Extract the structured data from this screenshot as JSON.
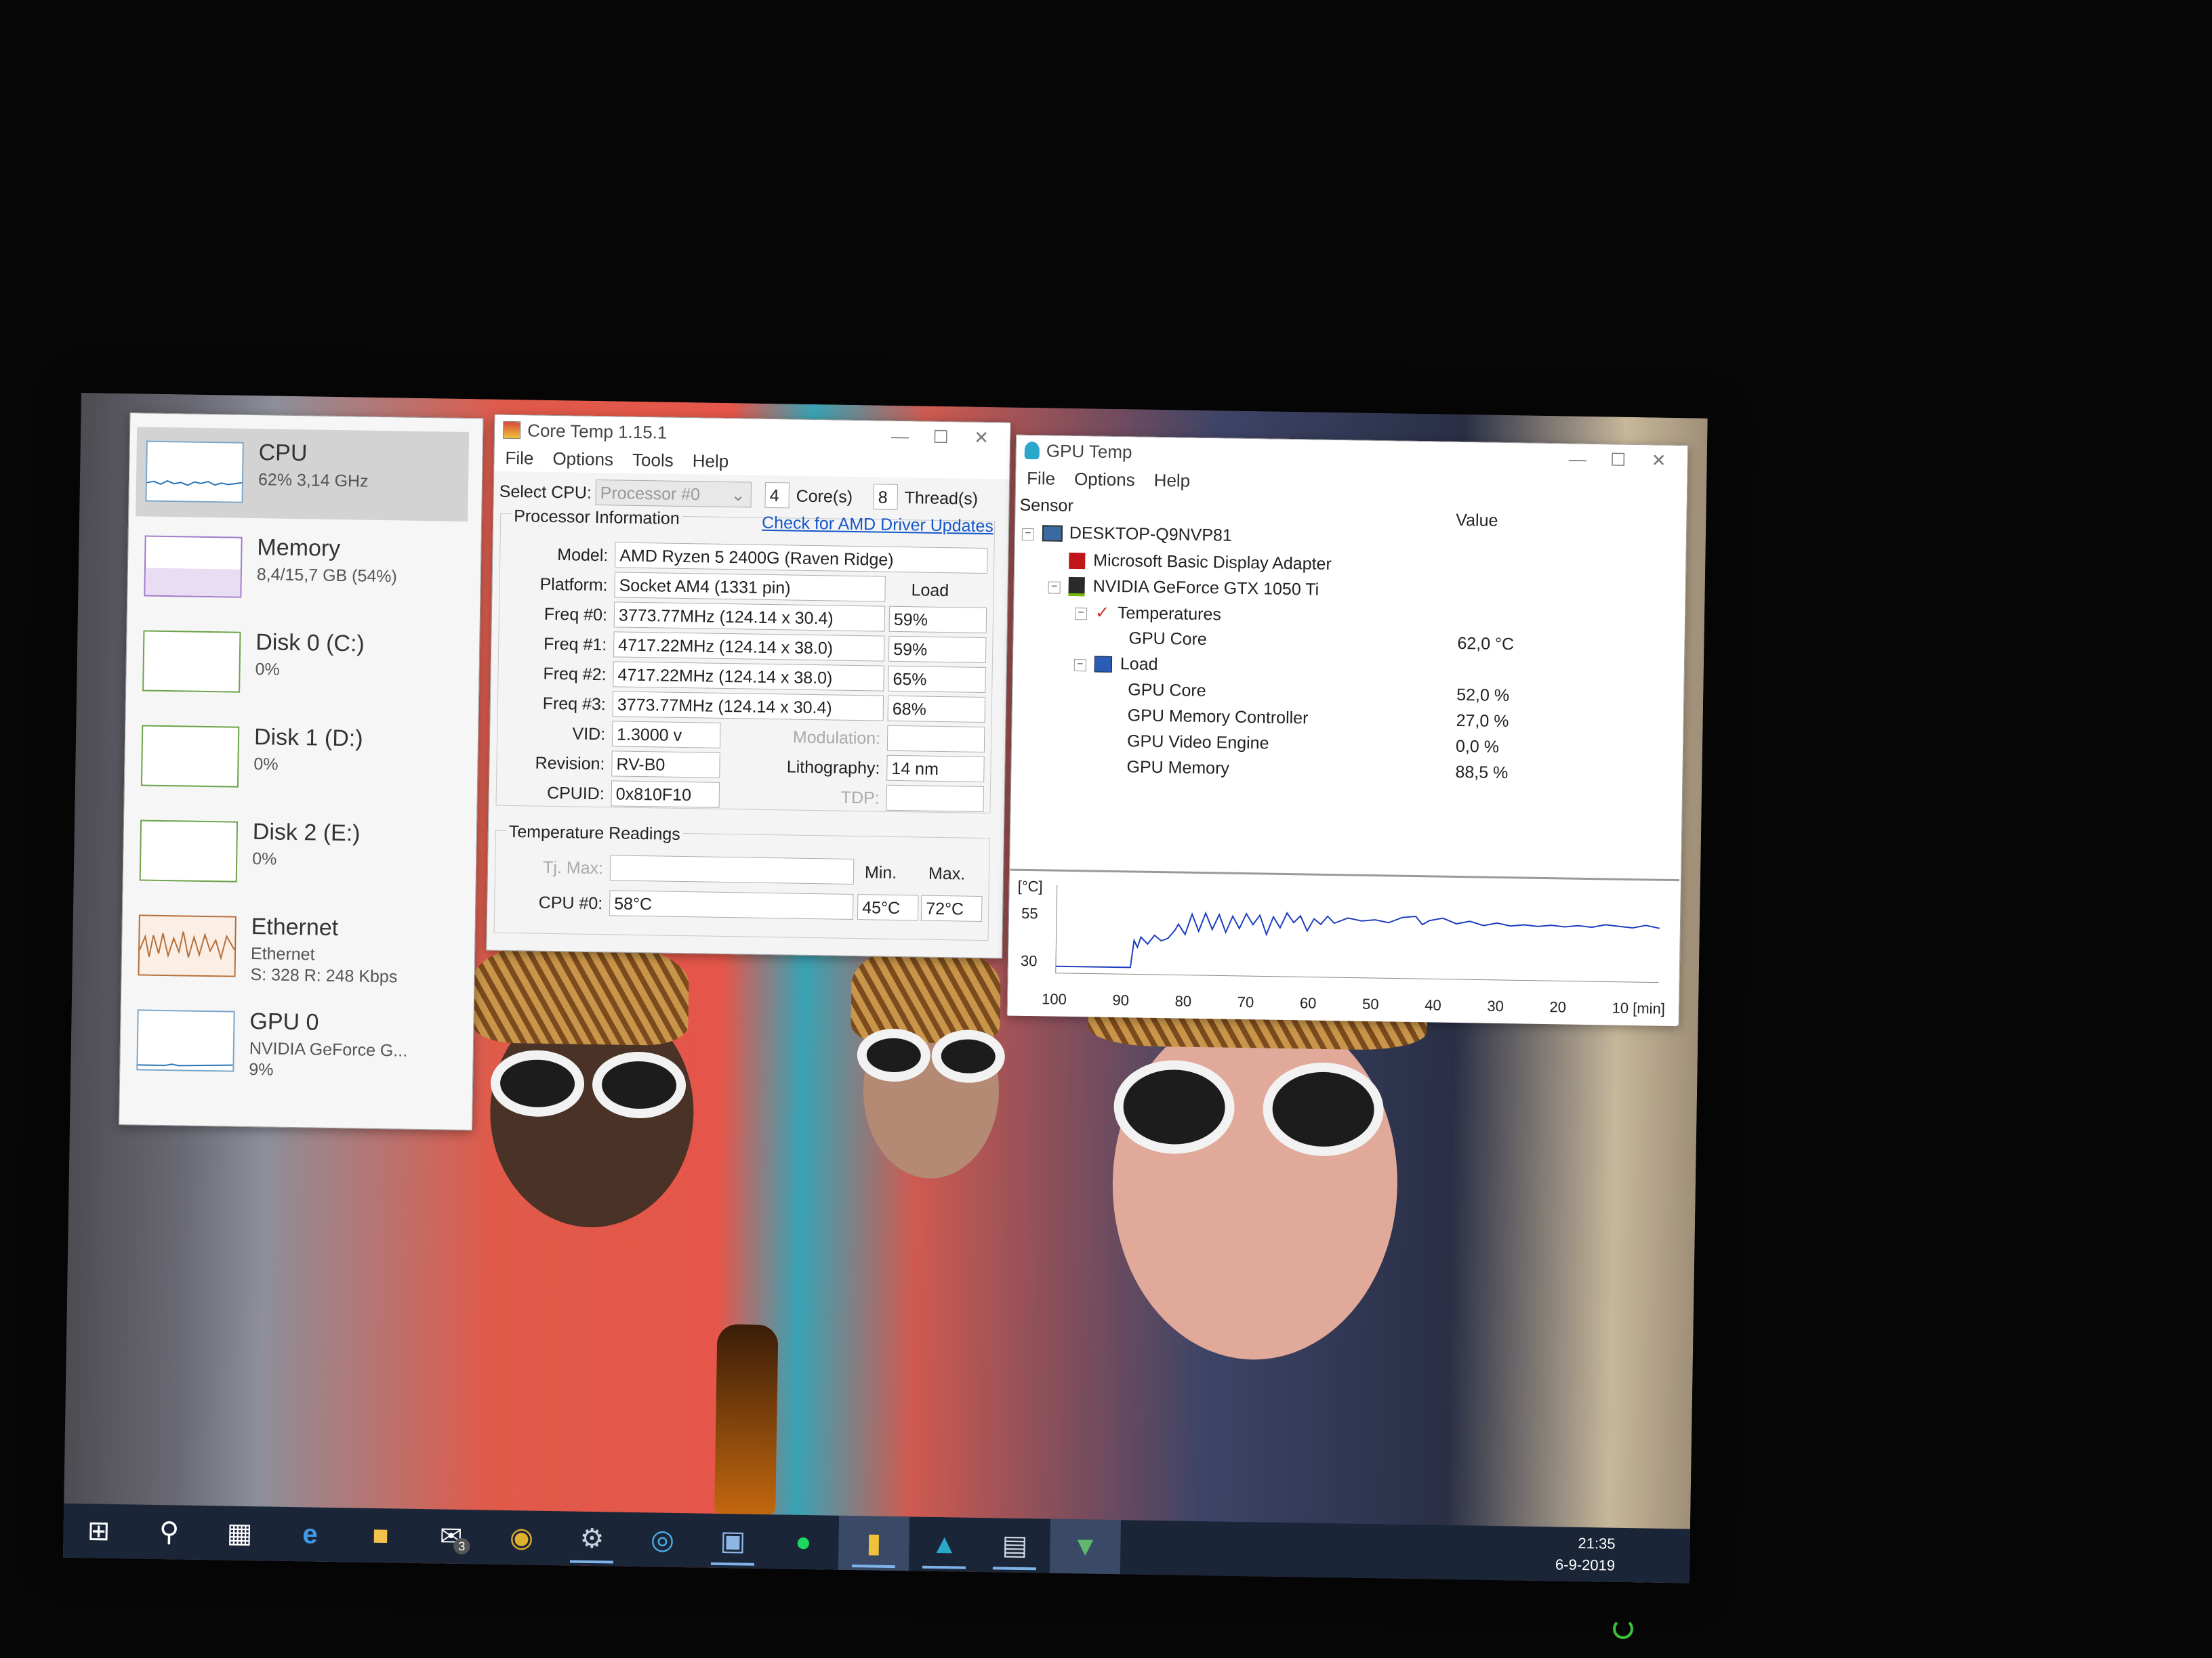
{
  "taskmgr": {
    "items": [
      {
        "name": "CPU",
        "sub1": "62% 3,14 GHz",
        "sub2": "",
        "sub3": ""
      },
      {
        "name": "Memory",
        "sub1": "8,4/15,7 GB (54%)",
        "sub2": "",
        "sub3": ""
      },
      {
        "name": "Disk 0 (C:)",
        "sub1": "0%",
        "sub2": "",
        "sub3": ""
      },
      {
        "name": "Disk 1 (D:)",
        "sub1": "0%",
        "sub2": "",
        "sub3": ""
      },
      {
        "name": "Disk 2 (E:)",
        "sub1": "0%",
        "sub2": "",
        "sub3": ""
      },
      {
        "name": "Ethernet",
        "sub1": "Ethernet",
        "sub2": "S: 328 R: 248 Kbps",
        "sub3": ""
      },
      {
        "name": "GPU 0",
        "sub1": "NVIDIA GeForce G...",
        "sub2": "9%",
        "sub3": ""
      }
    ]
  },
  "coretemp": {
    "title": "Core Temp 1.15.1",
    "menu": [
      "File",
      "Options",
      "Tools",
      "Help"
    ],
    "select_cpu_label": "Select CPU:",
    "processor": "Processor #0",
    "cores_value": "4",
    "cores_label": "Core(s)",
    "threads_value": "8",
    "threads_label": "Thread(s)",
    "proc_info_label": "Processor Information",
    "driver_link": "Check for AMD Driver Updates",
    "model_label": "Model:",
    "model": "AMD Ryzen 5 2400G (Raven Ridge)",
    "platform_label": "Platform:",
    "platform": "Socket AM4 (1331 pin)",
    "load_header": "Load",
    "freqs": [
      {
        "label": "Freq #0:",
        "value": "3773.77MHz (124.14 x 30.4)",
        "load": "59%"
      },
      {
        "label": "Freq #1:",
        "value": "4717.22MHz (124.14 x 38.0)",
        "load": "59%"
      },
      {
        "label": "Freq #2:",
        "value": "4717.22MHz (124.14 x 38.0)",
        "load": "65%"
      },
      {
        "label": "Freq #3:",
        "value": "3773.77MHz (124.14 x 30.4)",
        "load": "68%"
      }
    ],
    "vid_label": "VID:",
    "vid": "1.3000 v",
    "modulation_label": "Modulation:",
    "revision_label": "Revision:",
    "revision": "RV-B0",
    "lithography_label": "Lithography:",
    "lithography": "14 nm",
    "cpuid_label": "CPUID:",
    "cpuid": "0x810F10",
    "tdp_label": "TDP:",
    "temp_readings_label": "Temperature Readings",
    "tjmax_label": "Tj. Max:",
    "min_header": "Min.",
    "max_header": "Max.",
    "cpu0_label": "CPU #0:",
    "cpu0_temp": "58°C",
    "cpu0_min": "45°C",
    "cpu0_max": "72°C"
  },
  "gputemp": {
    "title": "GPU Temp",
    "menu": [
      "File",
      "Options",
      "Help"
    ],
    "sensor_header": "Sensor",
    "value_header": "Value",
    "tree": [
      {
        "label": "DESKTOP-Q9NVP81",
        "value": ""
      },
      {
        "label": "Microsoft Basic Display Adapter",
        "value": ""
      },
      {
        "label": "NVIDIA GeForce GTX 1050 Ti",
        "value": ""
      },
      {
        "label": "Temperatures",
        "value": ""
      },
      {
        "label": "GPU Core",
        "value": "62,0 °C"
      },
      {
        "label": "Load",
        "value": ""
      },
      {
        "label": "GPU Core",
        "value": "52,0 %"
      },
      {
        "label": "GPU Memory Controller",
        "value": "27,0 %"
      },
      {
        "label": "GPU Video Engine",
        "value": "0,0 %"
      },
      {
        "label": "GPU Memory",
        "value": "88,5 %"
      }
    ],
    "graph": {
      "unit": "[°C]",
      "y_ticks": [
        "55",
        "30"
      ],
      "x_ticks": [
        "100",
        "90",
        "80",
        "70",
        "60",
        "50",
        "40",
        "30",
        "20",
        "10 [min]"
      ],
      "line_color": "#1f3fbf"
    }
  },
  "taskbar": {
    "icons": [
      "windows-start-icon",
      "search-icon",
      "task-view-icon",
      "edge-icon",
      "file-explorer-icon",
      "mail-icon",
      "chrome-icon",
      "steam-icon",
      "uplay-icon",
      "photos-icon",
      "spotify-icon",
      "coretemp-icon",
      "gputemp-icon",
      "taskmgr-icon",
      "vpn-icon"
    ],
    "mail_badge": "3",
    "time": "21:35",
    "date": "6-9-2019"
  }
}
